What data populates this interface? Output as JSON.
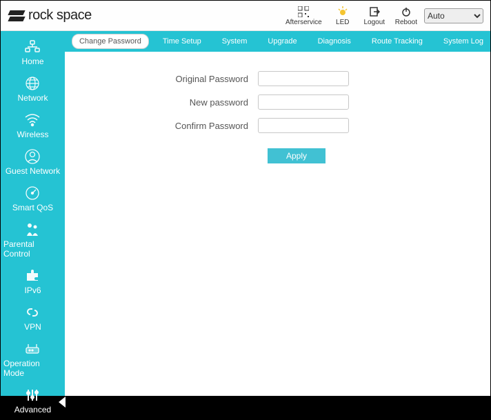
{
  "brand": "rock space",
  "header": {
    "actions": [
      {
        "id": "afterservice",
        "label": "Afterservice"
      },
      {
        "id": "led",
        "label": "LED"
      },
      {
        "id": "logout",
        "label": "Logout"
      },
      {
        "id": "reboot",
        "label": "Reboot"
      }
    ],
    "language_selected": "Auto"
  },
  "sidebar": {
    "items": [
      {
        "id": "home",
        "label": "Home"
      },
      {
        "id": "network",
        "label": "Network"
      },
      {
        "id": "wireless",
        "label": "Wireless"
      },
      {
        "id": "guest-network",
        "label": "Guest Network"
      },
      {
        "id": "smart-qos",
        "label": "Smart QoS"
      },
      {
        "id": "parental-control",
        "label": "Parental Control"
      },
      {
        "id": "ipv6",
        "label": "IPv6"
      },
      {
        "id": "vpn",
        "label": "VPN"
      },
      {
        "id": "operation-mode",
        "label": "Operation Mode"
      },
      {
        "id": "advanced",
        "label": "Advanced",
        "active": true
      }
    ]
  },
  "tabs": [
    {
      "id": "change-password",
      "label": "Change Password",
      "active": true
    },
    {
      "id": "time-setup",
      "label": "Time Setup"
    },
    {
      "id": "system",
      "label": "System"
    },
    {
      "id": "upgrade",
      "label": "Upgrade"
    },
    {
      "id": "diagnosis",
      "label": "Diagnosis"
    },
    {
      "id": "route-tracking",
      "label": "Route Tracking"
    },
    {
      "id": "system-log",
      "label": "System Log"
    }
  ],
  "form": {
    "original_password_label": "Original Password",
    "new_password_label": "New password",
    "confirm_password_label": "Confirm Password",
    "original_password_value": "",
    "new_password_value": "",
    "confirm_password_value": "",
    "apply_label": "Apply"
  }
}
